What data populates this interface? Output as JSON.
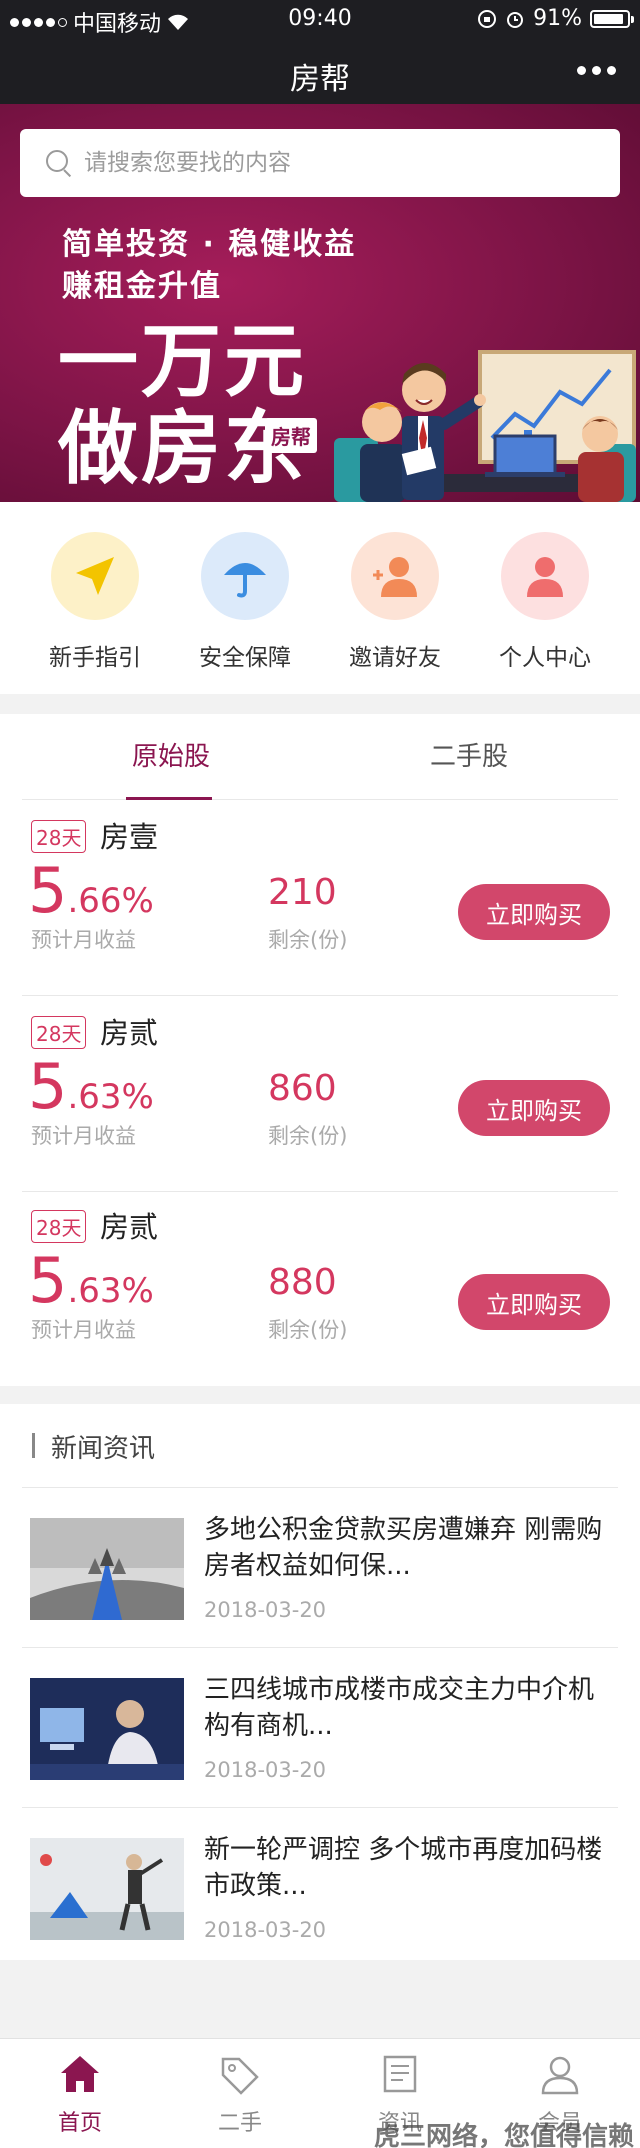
{
  "status": {
    "carrier": "中国移动",
    "time": "09:40",
    "battery": "91%",
    "battery_level": 0.91
  },
  "nav": {
    "title": "房帮"
  },
  "search": {
    "placeholder": "请搜索您要找的内容"
  },
  "banner": {
    "line1": "简单投资 · 稳健收益",
    "line2": "赚租金升值",
    "big1": "一万元",
    "big2": "做房东",
    "badge": "房帮"
  },
  "quick": [
    {
      "label": "新手指引",
      "icon": "paper-plane-icon",
      "bg": "#fdf1c8",
      "color": "#f3c400"
    },
    {
      "label": "安全保障",
      "icon": "umbrella-icon",
      "bg": "#dceafa",
      "color": "#3b8de0"
    },
    {
      "label": "邀请好友",
      "icon": "add-friend-icon",
      "bg": "#fde3d6",
      "color": "#f28a57"
    },
    {
      "label": "个人中心",
      "icon": "user-icon",
      "bg": "#fde0e0",
      "color": "#ef6d6d"
    }
  ],
  "tabs": [
    "原始股",
    "二手股"
  ],
  "products": [
    {
      "days": "28天",
      "name": "房壹",
      "rate_int": "5",
      "rate_dec": ".66%",
      "rate_label": "预计月收益",
      "remain": "210",
      "remain_label": "剩余(份)",
      "buy": "立即购买"
    },
    {
      "days": "28天",
      "name": "房贰",
      "rate_int": "5",
      "rate_dec": ".63%",
      "rate_label": "预计月收益",
      "remain": "860",
      "remain_label": "剩余(份)",
      "buy": "立即购买"
    },
    {
      "days": "28天",
      "name": "房贰",
      "rate_int": "5",
      "rate_dec": ".63%",
      "rate_label": "预计月收益",
      "remain": "880",
      "remain_label": "剩余(份)",
      "buy": "立即购买"
    }
  ],
  "news": {
    "heading": "新闻资讯",
    "items": [
      {
        "title": "多地公积金贷款买房遭嫌弃 刚需购房者权益如何保...",
        "date": "2018-03-20"
      },
      {
        "title": "三四线城市成楼市成交主力中介机构有商机...",
        "date": "2018-03-20"
      },
      {
        "title": "新一轮严调控 多个城市再度加码楼市政策...",
        "date": "2018-03-20"
      }
    ]
  },
  "tabbar": [
    {
      "label": "首页",
      "icon": "home-icon"
    },
    {
      "label": "二手",
      "icon": "tag-icon"
    },
    {
      "label": "资讯",
      "icon": "news-icon"
    },
    {
      "label": "会员",
      "icon": "member-icon"
    }
  ],
  "watermark": "虎三网络，您值得信赖",
  "colors": {
    "brand": "#8b1650",
    "accent": "#d2476b",
    "dark": "#1e1e22"
  }
}
